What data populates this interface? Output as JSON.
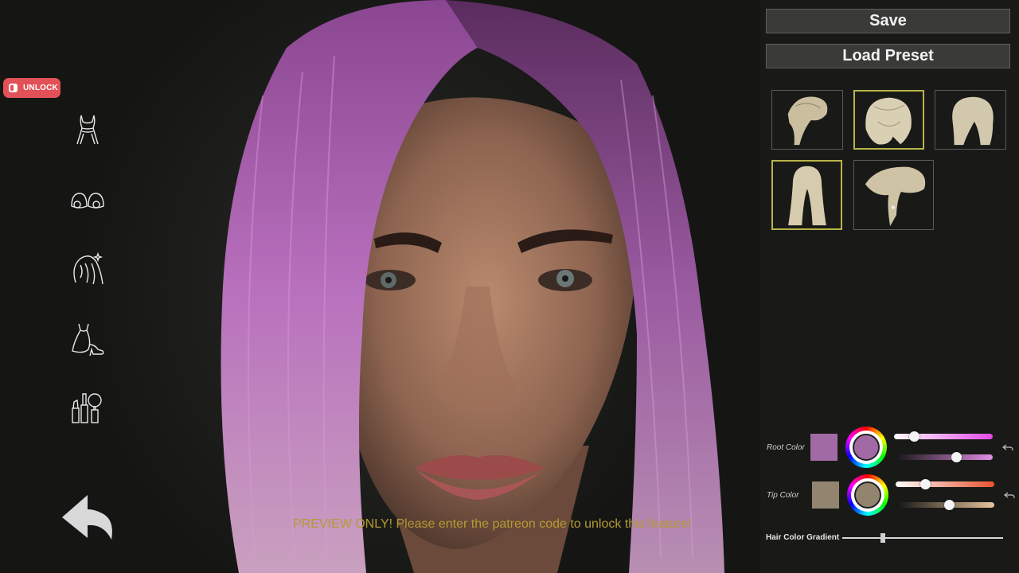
{
  "left_toolbar": {
    "unlock_label": "UNLOCK",
    "tools": [
      {
        "name": "outfit-icon"
      },
      {
        "name": "eyes-icon"
      },
      {
        "name": "hair-icon"
      },
      {
        "name": "dress-shoes-icon"
      },
      {
        "name": "makeup-icon"
      }
    ],
    "back_icon": "back-arrow-icon"
  },
  "notice": {
    "preview_message": "PREVIEW ONLY! Please enter the patreon code to unlock this feature!",
    "color": "#b59a32"
  },
  "panel": {
    "save_label": "Save",
    "load_preset_label": "Load Preset",
    "hairstyles": [
      {
        "style": "ponytail",
        "selected": false
      },
      {
        "style": "messy-bob",
        "selected": true
      },
      {
        "style": "shoulder-bob",
        "selected": false
      },
      {
        "style": "long-straight",
        "selected": true
      },
      {
        "style": "side-swept-ponytail",
        "selected": false
      }
    ],
    "root_color": {
      "label": "Root Color",
      "swatch": "#a26aa4",
      "saturation": 0.2,
      "brightness": 0.63
    },
    "tip_color": {
      "label": "Tip Color",
      "swatch": "#938470",
      "saturation": 0.3,
      "brightness": 0.54
    },
    "gradient": {
      "label": "Hair Color Gradient",
      "value": 0.25
    }
  },
  "colors": {
    "hair": "#b86cc0",
    "selected_outline": "#b9b44a",
    "unlock_bg": "#e25157"
  }
}
